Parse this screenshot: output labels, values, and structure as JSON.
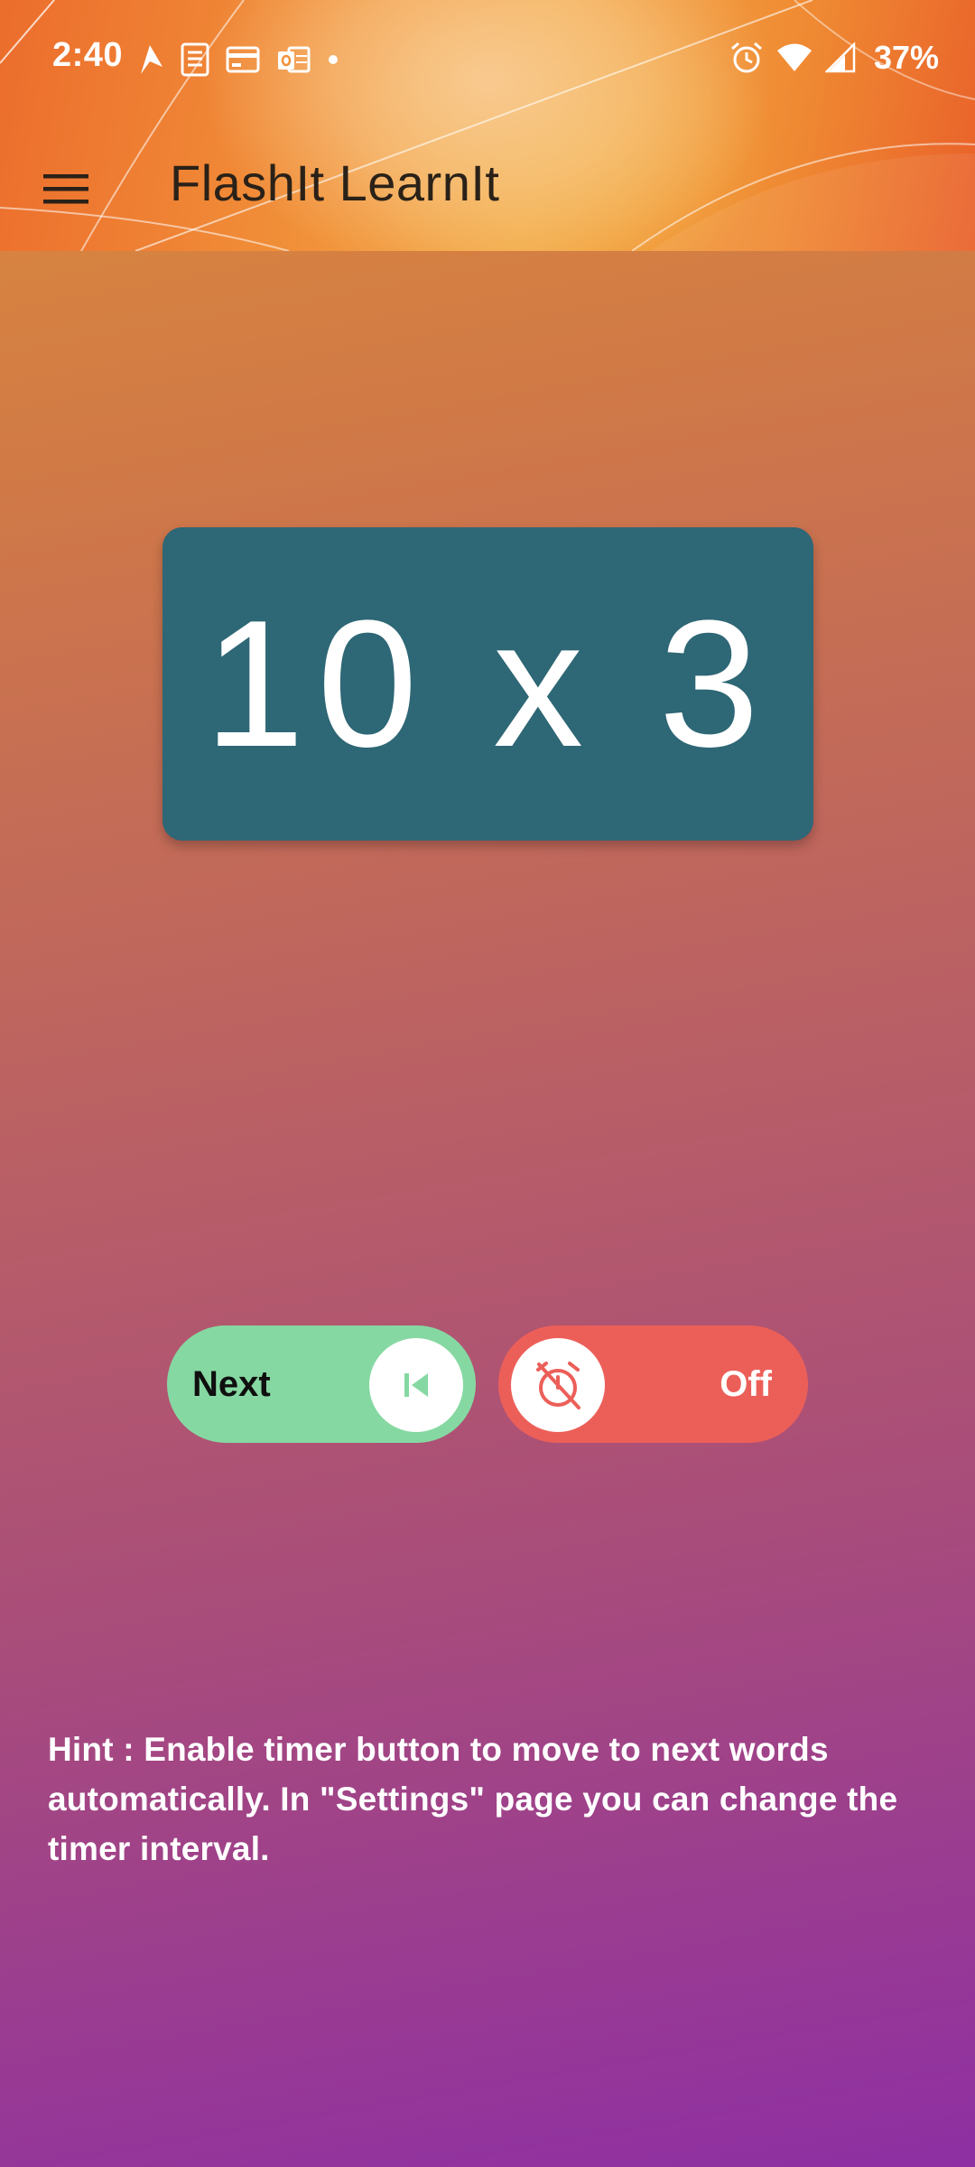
{
  "status_bar": {
    "time": "2:40",
    "battery": "37%",
    "left_icons": [
      "navigation-icon",
      "document-icon",
      "card-icon",
      "outlook-icon",
      "dot-icon"
    ],
    "right_icons": [
      "alarm-icon",
      "wifi-icon",
      "signal-icon"
    ]
  },
  "app_bar": {
    "title": "FlashIt LearnIt",
    "menu_icon": "hamburger-menu-icon"
  },
  "flashcard": {
    "text": "10 x 3",
    "background": "#2e6775"
  },
  "controls": {
    "next": {
      "label": "Next",
      "icon": "skip-previous-icon",
      "color": "#86d8a2"
    },
    "timer": {
      "label": "Off",
      "icon": "timer-off-icon",
      "color": "#ec5f59"
    }
  },
  "hint": {
    "text": "Hint : Enable timer button to move to next words automatically. In \"Settings\" page you can change the timer interval."
  },
  "colors": {
    "header_accent": "#f1923a",
    "background_top": "#de8d3a",
    "background_bottom": "#8e2fa3"
  }
}
